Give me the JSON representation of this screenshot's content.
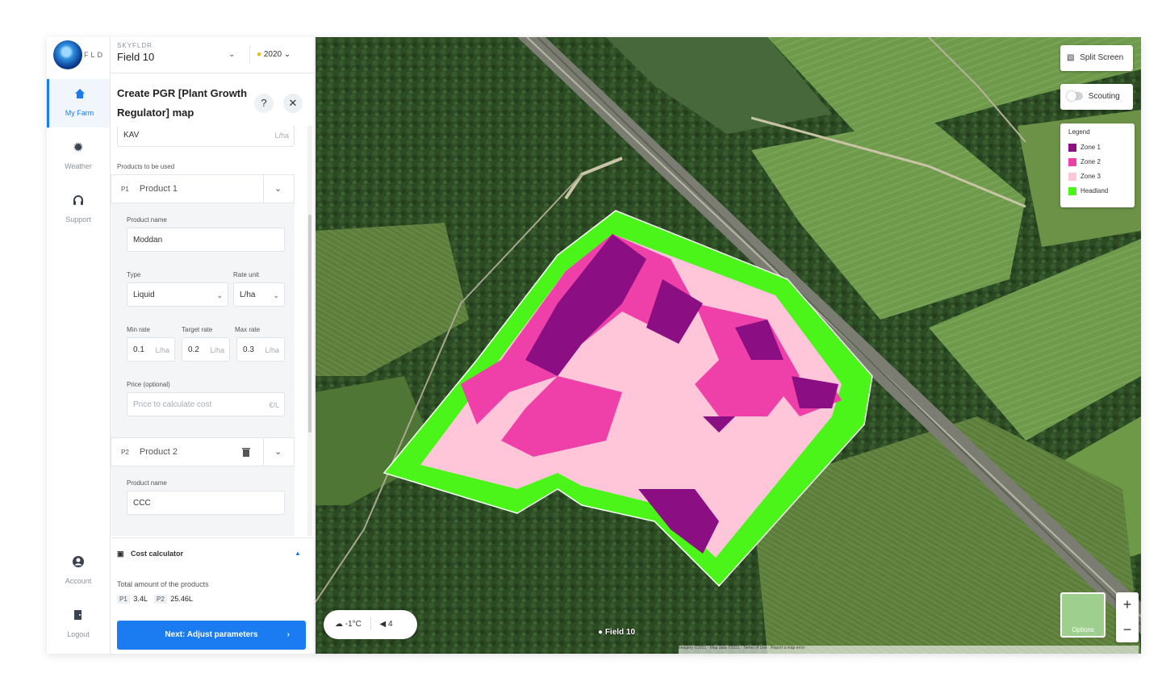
{
  "nav": {
    "logo_text": "FLD",
    "items": [
      {
        "label": "My Farm",
        "icon": "home-icon"
      },
      {
        "label": "Weather",
        "icon": "sun-icon"
      },
      {
        "label": "Support",
        "icon": "headset-icon"
      },
      {
        "label": "Account",
        "icon": "user-icon"
      },
      {
        "label": "Logout",
        "icon": "logout-icon"
      }
    ]
  },
  "selector": {
    "farm_label": "SKYFLDR",
    "field_name": "Field 10",
    "year": "2020"
  },
  "panel": {
    "title": "Create PGR [Plant Growth Regulator] map",
    "partial_field_value": "KAV",
    "partial_field_unit": "L/ha",
    "products_label": "Products to be used",
    "product1": {
      "badge": "P1",
      "header": "Product 1",
      "name_label": "Product name",
      "name_value": "Moddan",
      "type_label": "Type",
      "type_value": "Liquid",
      "rate_unit_label": "Rate unit",
      "rate_unit_value": "L/ha",
      "min_label": "Min rate",
      "min_value": "0.1",
      "target_label": "Target rate",
      "target_value": "0.2",
      "max_label": "Max rate",
      "max_value": "0.3",
      "rate_suffix": "L/ha",
      "price_label": "Price (optional)",
      "price_placeholder": "Price to calculate cost",
      "price_unit": "€/L"
    },
    "product2": {
      "badge": "P2",
      "header": "Product 2",
      "name_label": "Product name",
      "name_value": "CCC"
    }
  },
  "cost": {
    "title": "Cost calculator",
    "total_label": "Total amount of the products",
    "p1_tag": "P1",
    "p1_value": "3.4L",
    "p2_tag": "P2",
    "p2_value": "25.46L",
    "next_button": "Next: Adjust parameters"
  },
  "map": {
    "split_screen": "Split Screen",
    "scouting": "Scouting",
    "legend_title": "Legend",
    "legend": [
      {
        "label": "Zone 1",
        "color": "#8b0f82"
      },
      {
        "label": "Zone 2",
        "color": "#ef3fa9"
      },
      {
        "label": "Zone 3",
        "color": "#ffc6d9"
      },
      {
        "label": "Headland",
        "color": "#4bf519"
      }
    ],
    "temperature": "-1°C",
    "wind": "4",
    "field_label": "Field 10",
    "options_label": "Options",
    "zoom_in": "+",
    "zoom_out": "−",
    "attribution": "Imagery ©2021 · Map data ©2021 · Terms of Use · Report a map error"
  }
}
